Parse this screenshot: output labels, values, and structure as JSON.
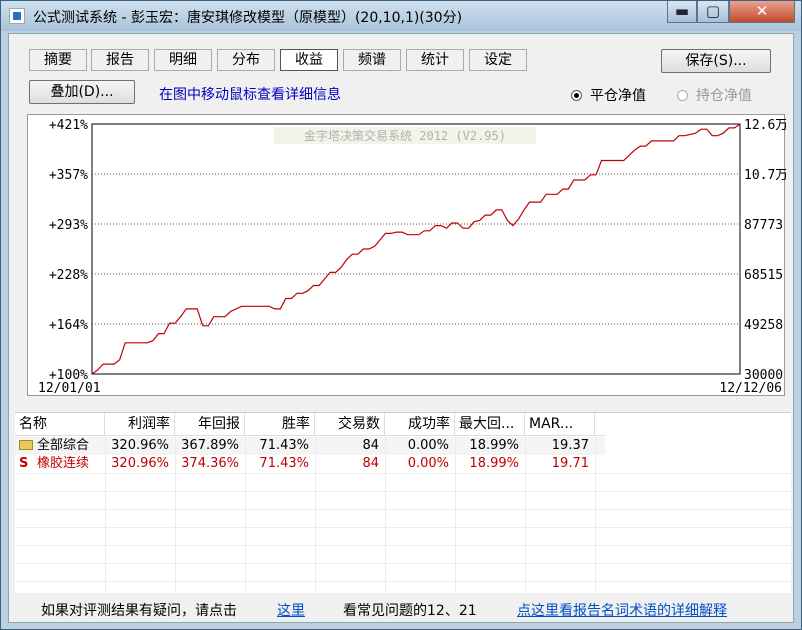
{
  "window": {
    "title": "公式测试系统 - 彭玉宏：唐安琪修改模型（原模型）(20,10,1)(30分)",
    "min_label": "▬",
    "max_label": "▢",
    "close_label": "✕"
  },
  "tabs": [
    {
      "label": "摘要"
    },
    {
      "label": "报告"
    },
    {
      "label": "明细"
    },
    {
      "label": "分布"
    },
    {
      "label": "收益",
      "active": true
    },
    {
      "label": "频谱"
    },
    {
      "label": "统计"
    },
    {
      "label": "设定"
    }
  ],
  "toolbar": {
    "save_label": "保存(S)...",
    "overlay_label": "叠加(D)...",
    "hint": "在图中移动鼠标查看详细信息",
    "radio_close_value": "平仓净值",
    "radio_hold_value": "持仓净值"
  },
  "chart_data": {
    "type": "line",
    "watermark": "金字塔决策交易系统 2012 (V2.95)",
    "x_start": "12/01/01",
    "x_end": "12/12/06",
    "left_ticks": [
      "+421%",
      "+357%",
      "+293%",
      "+228%",
      "+164%",
      "+100%"
    ],
    "right_ticks": [
      "12.6万",
      "10.7万",
      "87773",
      "68515",
      "49258",
      "30000"
    ],
    "ylim": [
      30000,
      126000
    ],
    "grid": true,
    "line_color": "#c00000",
    "series": [
      {
        "values": [
          30000,
          31500,
          33800,
          33800,
          33800,
          35500,
          42000,
          42000,
          42000,
          42000,
          42000,
          42800,
          45500,
          45500,
          49500,
          49500,
          52000,
          55000,
          55000,
          55000,
          48500,
          48500,
          52000,
          52000,
          52000,
          54000,
          55000,
          56000,
          56000,
          56000,
          56000,
          56000,
          56000,
          55000,
          55000,
          59000,
          59000,
          61000,
          61000,
          62000,
          64000,
          64000,
          66500,
          69000,
          69000,
          71000,
          74000,
          76000,
          76000,
          78000,
          78000,
          79000,
          81500,
          84000,
          84000,
          84500,
          84500,
          83500,
          83500,
          83500,
          85000,
          85000,
          87000,
          87000,
          86000,
          88000,
          88000,
          86000,
          86000,
          88500,
          89000,
          91000,
          91000,
          93000,
          93000,
          89000,
          87000,
          89500,
          93000,
          96000,
          96000,
          96000,
          99000,
          99000,
          99000,
          101000,
          101000,
          104500,
          104500,
          104500,
          106500,
          106500,
          112000,
          112000,
          112000,
          112000,
          112000,
          114000,
          116000,
          117500,
          117500,
          119500,
          119500,
          119500,
          119500,
          119500,
          121500,
          121500,
          122000,
          122500,
          124000,
          124000,
          121500,
          121500,
          122500,
          124500,
          124500,
          126000
        ]
      }
    ]
  },
  "table": {
    "headers": [
      "名称",
      "利润率",
      "年回报",
      "胜率",
      "交易数",
      "成功率",
      "最大回...",
      "MAR..."
    ],
    "rows": [
      {
        "name": "全部综合",
        "profit": "320.96%",
        "annual": "367.89%",
        "win": "71.43%",
        "trades": "84",
        "success": "0.00%",
        "maxdd": "18.99%",
        "mar": "19.37"
      },
      {
        "name": "橡胶连续",
        "profit": "320.96%",
        "annual": "374.36%",
        "win": "71.43%",
        "trades": "84",
        "success": "0.00%",
        "maxdd": "18.99%",
        "mar": "19.71"
      }
    ],
    "row2_icon": "S"
  },
  "footer": {
    "question": "如果对评测结果有疑问，请点击",
    "here_link": "这里",
    "faq": "看常见问题的12、21",
    "glossary_link": "点这里看报告名词术语的详细解释"
  }
}
